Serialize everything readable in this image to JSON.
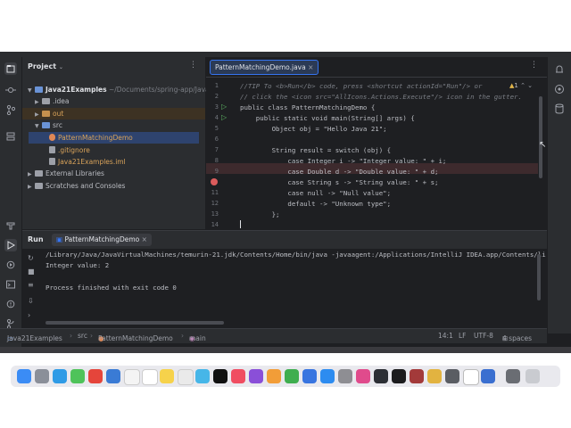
{
  "colors": {
    "accent": "#3574f0",
    "breakpoint": "#db5c5c",
    "run_green": "#5fb865",
    "folder_orange": "#c5904e",
    "folder_blue": "#6a93d6"
  },
  "project_panel": {
    "title": "Project",
    "tree": [
      {
        "label": "Java21Examples",
        "extra": "~/Documents/spring-app/Java21"
      },
      {
        "label": ".idea"
      },
      {
        "label": "out"
      },
      {
        "label": "src"
      },
      {
        "label": "PatternMatchingDemo"
      },
      {
        "label": ".gitignore"
      },
      {
        "label": "Java21Examples.iml"
      },
      {
        "label": "External Libraries"
      },
      {
        "label": "Scratches and Consoles"
      }
    ]
  },
  "editor": {
    "tab_label": "PatternMatchingDemo.java",
    "warning_count": "1",
    "lines": [
      {
        "num": "1",
        "text": "//TIP To <b>Run</b> code, press <shortcut actionId=\"Run\"/> or"
      },
      {
        "num": "2",
        "text": "// click the <icon src=\"AllIcons.Actions.Execute\"/> icon in the gutter."
      },
      {
        "num": "3",
        "text": "public class PatternMatchingDemo {"
      },
      {
        "num": "4",
        "text": "    public static void main(String[] args) {"
      },
      {
        "num": "5",
        "text": "        Object obj = \"Hello Java 21\";"
      },
      {
        "num": "6",
        "text": ""
      },
      {
        "num": "7",
        "text": "        String result = switch (obj) {"
      },
      {
        "num": "8",
        "text": "            case Integer i -> \"Integer value: \" + i;"
      },
      {
        "num": "9",
        "text": "            case Double d -> \"Double value: \" + d;"
      },
      {
        "num": "10",
        "text": "            case String s -> \"String value: \" + s;"
      },
      {
        "num": "11",
        "text": "            case null -> \"Null value\";"
      },
      {
        "num": "12",
        "text": "            default -> \"Unknown type\";"
      },
      {
        "num": "13",
        "text": "        };"
      },
      {
        "num": "14",
        "text": ""
      }
    ]
  },
  "run_panel": {
    "label": "Run",
    "tab_label": "PatternMatchingDemo",
    "console": [
      "/Library/Java/JavaVirtualMachines/temurin-21.jdk/Contents/Home/bin/java -javaagent:/Applications/IntelliJ IDEA.app/Contents/li",
      "Integer value: 2",
      "",
      "Process finished with exit code 0"
    ]
  },
  "status_bar": {
    "breadcrumb": [
      "Java21Examples",
      "src",
      "PatternMatchingDemo",
      "main"
    ],
    "position": "14:1",
    "line_sep": "LF",
    "encoding": "UTF-8",
    "indent": "4 spaces"
  }
}
